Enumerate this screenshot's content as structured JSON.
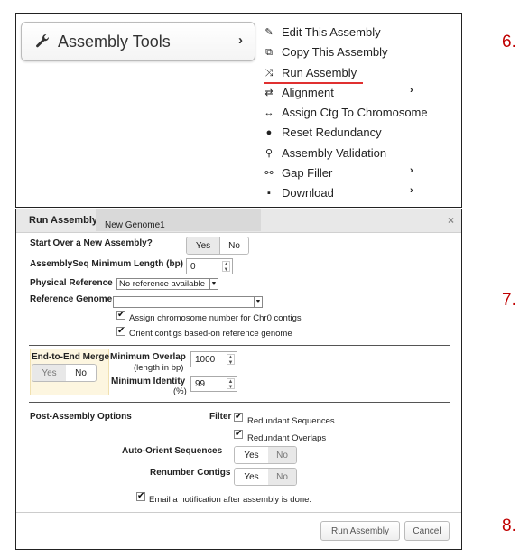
{
  "steps": [
    "6.",
    "7.",
    "8."
  ],
  "tools_button": {
    "label": "Assembly Tools",
    "icon": "wrench-icon",
    "chevron": "›"
  },
  "menu": [
    {
      "label": "Edit This Assembly",
      "icon": "pencil-icon",
      "glyph": "✎",
      "sub": ""
    },
    {
      "label": "Copy This Assembly",
      "icon": "copy-icon",
      "glyph": "⧉",
      "sub": ""
    },
    {
      "label": "Run Assembly",
      "icon": "shuffle-icon",
      "glyph": "⤨",
      "sub": ""
    },
    {
      "label": "Alignment",
      "icon": "arrows-icon",
      "glyph": "⇄",
      "sub": "›"
    },
    {
      "label": "Assign Ctg To Chromosome",
      "icon": "resize-icon",
      "glyph": "↔",
      "sub": ""
    },
    {
      "label": "Reset Redundancy",
      "icon": "circle-icon",
      "glyph": "●",
      "sub": ""
    },
    {
      "label": "Assembly Validation",
      "icon": "search-icon",
      "glyph": "⚲",
      "sub": ""
    },
    {
      "label": "Gap Filler",
      "icon": "link-icon",
      "glyph": "⚯",
      "sub": "›"
    },
    {
      "label": "Download",
      "icon": "save-icon",
      "glyph": "▪",
      "sub": "›"
    }
  ],
  "dialog": {
    "title": "Run Assembly",
    "tab": "New Genome1",
    "close": "×",
    "start_over": {
      "label": "Start Over a New Assembly?",
      "yes": "Yes",
      "no": "No"
    },
    "min_length": {
      "label": "AssemblySeq Minimum Length (bp)",
      "value": "0"
    },
    "physical_ref": {
      "label": "Physical Reference",
      "value": "No reference available"
    },
    "ref_genome": {
      "label": "Reference Genome",
      "value": ""
    },
    "assign_chr0": "Assign chromosome number for Chr0 contigs",
    "orient_contigs": "Orient contigs based-on reference genome",
    "e2e": {
      "label": "End-to-End Merge",
      "yes": "Yes",
      "no": "No"
    },
    "min_overlap": {
      "label": "Minimum Overlap",
      "sub": "(length in bp)",
      "value": "1000"
    },
    "min_identity": {
      "label": "Minimum Identity",
      "sub": "(%)",
      "value": "99"
    },
    "post": {
      "label": "Post-Assembly Options",
      "filter": "Filter",
      "redundant_seq": "Redundant Sequences",
      "redundant_ovl": "Redundant Overlaps"
    },
    "auto_orient": {
      "label": "Auto-Orient Sequences",
      "yes": "Yes",
      "no": "No"
    },
    "renumber": {
      "label": "Renumber Contigs",
      "yes": "Yes",
      "no": "No"
    },
    "email": "Email a notification after assembly is done.",
    "run_btn": "Run Assembly",
    "cancel_btn": "Cancel"
  },
  "colors": {
    "accent": "#c00000",
    "underline": "#e03030"
  }
}
